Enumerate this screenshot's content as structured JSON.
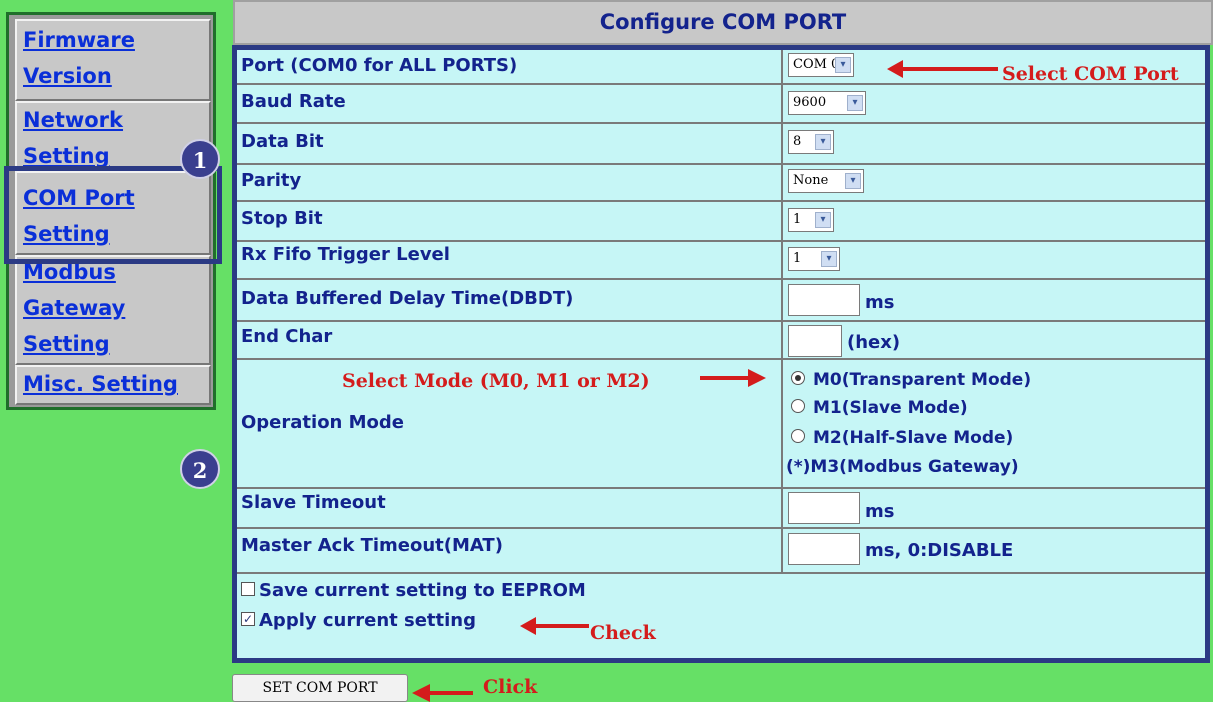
{
  "nav": {
    "items": [
      {
        "label_lines": [
          "Firmware",
          "Version"
        ]
      },
      {
        "label_lines": [
          "Network",
          "Setting"
        ]
      },
      {
        "label_lines": [
          "COM Port",
          "Setting"
        ]
      },
      {
        "label_lines": [
          "Modbus",
          "Gateway",
          "Setting"
        ]
      },
      {
        "label_lines": [
          "Misc. Setting"
        ]
      }
    ]
  },
  "badges": [
    "1",
    "2"
  ],
  "page": {
    "title": "Configure COM PORT"
  },
  "form": {
    "port": {
      "label": "Port (COM0 for ALL PORTS)",
      "value": "COM 0"
    },
    "baud_rate": {
      "label": "Baud Rate",
      "value": "9600"
    },
    "data_bit": {
      "label": "Data Bit",
      "value": "8"
    },
    "parity": {
      "label": "Parity",
      "value": "None"
    },
    "stop_bit": {
      "label": "Stop Bit",
      "value": "1"
    },
    "rx_fifo": {
      "label": "Rx Fifo Trigger Level",
      "value": "1"
    },
    "dbdt": {
      "label": "Data Buffered Delay Time(DBDT)",
      "unit": "ms",
      "value": ""
    },
    "end_char": {
      "label": "End Char",
      "unit": "(hex)",
      "value": ""
    },
    "operation_mode": {
      "label": "Operation Mode",
      "options": [
        {
          "label": "M0(Transparent Mode)",
          "checked": true
        },
        {
          "label": "M1(Slave Mode)",
          "checked": false
        },
        {
          "label": "M2(Half-Slave Mode)",
          "checked": false
        }
      ],
      "note": "(*)M3(Modbus Gateway)"
    },
    "slave_timeout": {
      "label": "Slave Timeout",
      "unit": "ms",
      "value": ""
    },
    "mat": {
      "label": "Master Ack Timeout(MAT)",
      "unit": "ms, 0:DISABLE",
      "value": ""
    },
    "save_eeprom": {
      "label": "Save current setting to EEPROM",
      "checked": false
    },
    "apply_setting": {
      "label": "Apply current setting",
      "checked": true
    }
  },
  "submit": {
    "label": "SET COM PORT"
  },
  "annotations": {
    "select_com_port": "Select COM Port",
    "select_mode": "Select Mode (M0, M1 or M2)",
    "check": "Check",
    "click": "Click"
  },
  "colors": {
    "background": "#66e066",
    "panel": "#c6f6f6",
    "text": "#13238d",
    "link": "#0a2fd8",
    "annotation": "#d41c1c",
    "highlight_border": "#2b3a84"
  },
  "icons": {
    "dropdown": "chevron-down-icon"
  }
}
